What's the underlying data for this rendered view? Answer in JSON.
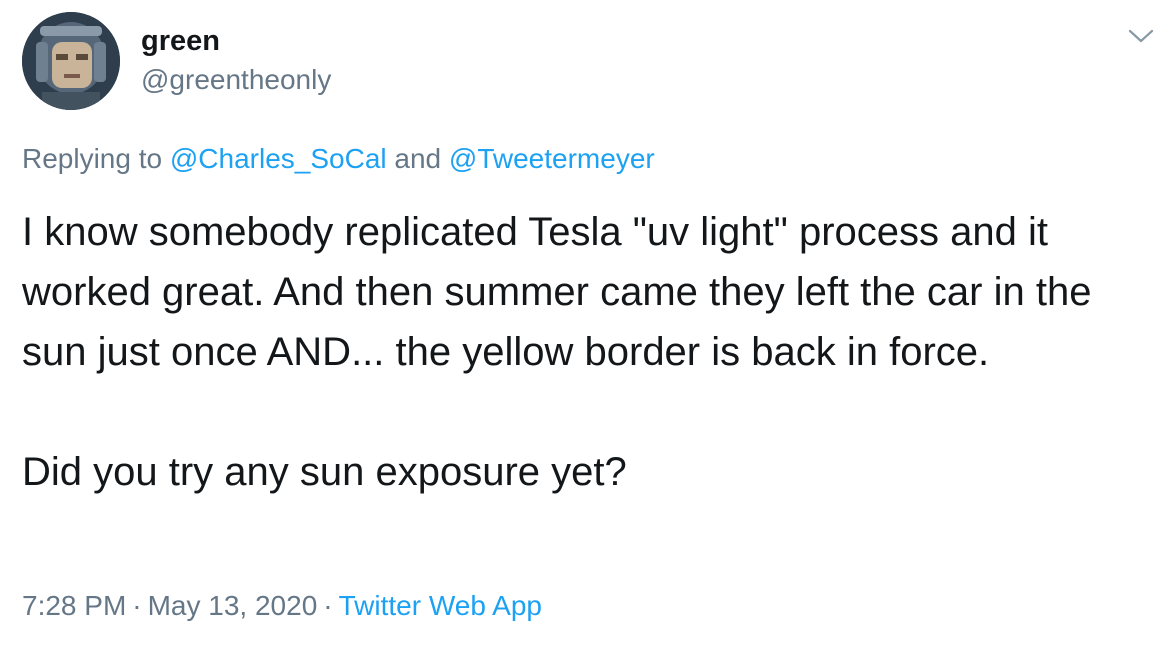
{
  "author": {
    "display_name": "green",
    "handle": "@greentheonly",
    "avatar_icon": "user-avatar-icon"
  },
  "reply_context": {
    "prefix": "Replying to",
    "first_user": "@Charles_SoCal",
    "joiner": "and",
    "second_user": "@Tweetermeyer"
  },
  "tweet": {
    "paragraph_1": "I know somebody replicated Tesla \"uv light\" process and it worked great. And then summer came they left the car in the sun just once AND... the yellow border is back in force.",
    "paragraph_2": "Did you try any sun exposure yet?"
  },
  "meta": {
    "time": "7:28 PM",
    "separator": "·",
    "date": "May 13, 2020",
    "source": "Twitter Web App"
  },
  "colors": {
    "text": "#14171a",
    "secondary": "#657786",
    "link": "#1da1f2"
  },
  "menu": {
    "icon": "chevron-down-icon"
  }
}
